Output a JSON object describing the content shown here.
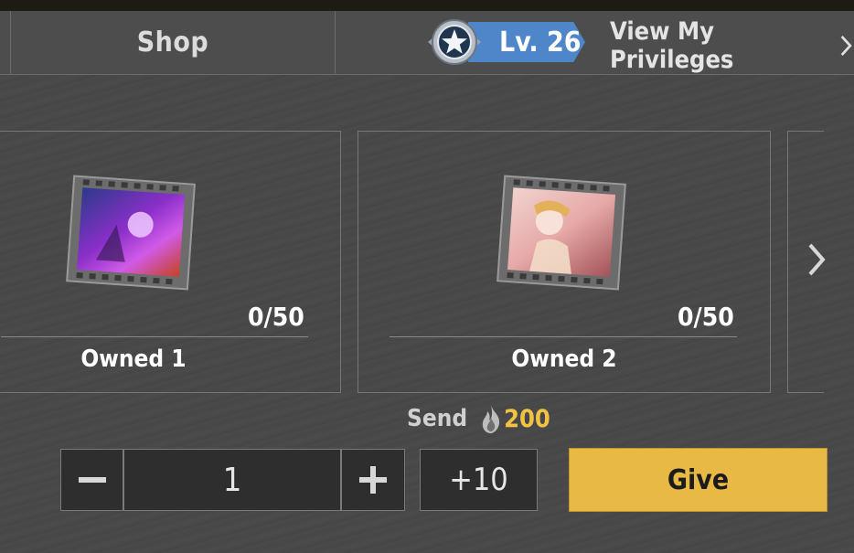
{
  "header": {
    "shop_tab_label": "Shop",
    "level_label": "Lv. 26",
    "privileges_link": "View My Privileges"
  },
  "items": [
    {
      "count": "0/50",
      "label": "Owned 1",
      "thumbnail_icon": "purple-hero-card-icon"
    },
    {
      "count": "0/50",
      "label": "Owned 2",
      "thumbnail_icon": "pink-heroine-card-icon"
    }
  ],
  "send": {
    "label": "Send",
    "amount": "200",
    "currency_icon": "flame-icon"
  },
  "controls": {
    "quantity": "1",
    "plus_ten_label": "+10",
    "give_label": "Give"
  },
  "colors": {
    "level_blue": "#4f86c9",
    "amount_gold": "#f2c343",
    "give_button": "#e8b944"
  }
}
